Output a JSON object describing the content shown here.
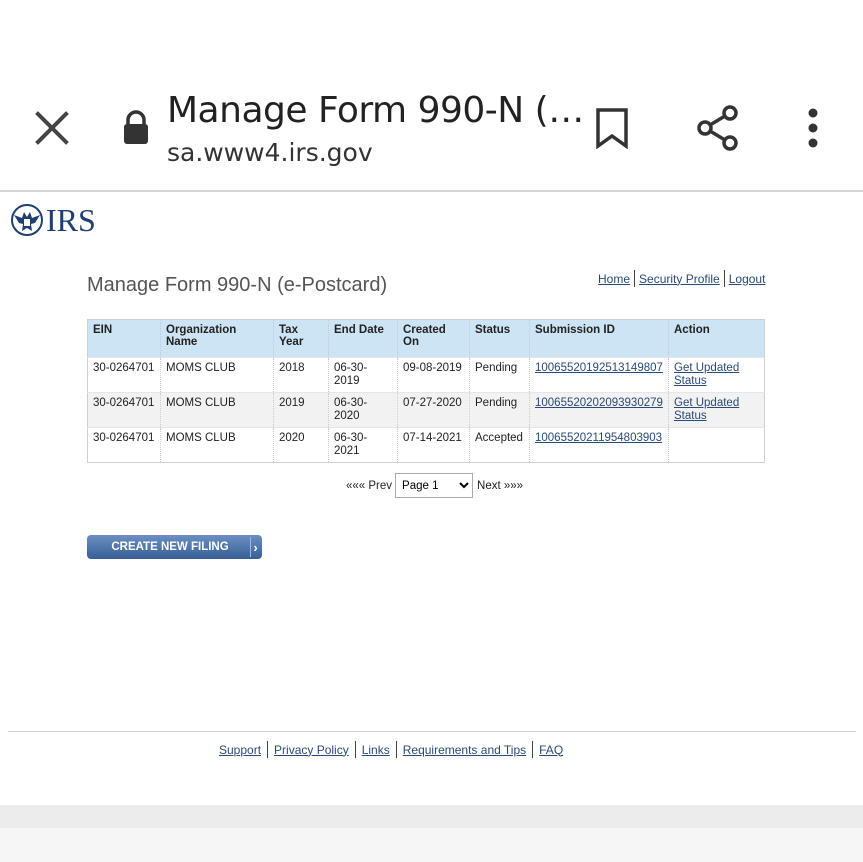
{
  "browser": {
    "tab_title": "Manage Form 990-N (…",
    "url": "sa.www4.irs.gov",
    "icons": [
      "close-icon",
      "lock-icon",
      "bookmark-icon",
      "share-icon",
      "more-icon"
    ]
  },
  "logo": {
    "text": "IRS",
    "color": "#1f3f73"
  },
  "page": {
    "title": "Manage Form 990-N (e-Postcard)",
    "top_links": [
      "Home",
      "Security Profile",
      "Logout"
    ]
  },
  "table": {
    "headers": [
      "EIN",
      "Organization Name",
      "Tax Year",
      "End Date",
      "Created On",
      "Status",
      "Submission ID",
      "Action"
    ],
    "rows": [
      {
        "ein": "30-0264701",
        "org": "MOMS CLUB",
        "year": "2018",
        "end": "06-30-2019",
        "created": "09-08-2019",
        "status": "Pending",
        "submission": "10065520192513149807",
        "action": "Get Updated Status"
      },
      {
        "ein": "30-0264701",
        "org": "MOMS CLUB",
        "year": "2019",
        "end": "06-30-2020",
        "created": "07-27-2020",
        "status": "Pending",
        "submission": "10065520202093930279",
        "action": "Get Updated Status"
      },
      {
        "ein": "30-0264701",
        "org": "MOMS CLUB",
        "year": "2020",
        "end": "06-30-2021",
        "created": "07-14-2021",
        "status": "Accepted",
        "submission": "10065520211954803903",
        "action": ""
      }
    ],
    "header_bg": "#cde4f4"
  },
  "pager": {
    "prev": "««« Prev",
    "selected": "Page 1",
    "next": "Next »»»"
  },
  "create_button": {
    "label": "CREATE NEW FILING",
    "color": "#375f96"
  },
  "footer": {
    "links": [
      "Support",
      "Privacy Policy",
      "Links",
      "Requirements and Tips",
      "FAQ"
    ]
  },
  "link_color": "#2a4a78"
}
